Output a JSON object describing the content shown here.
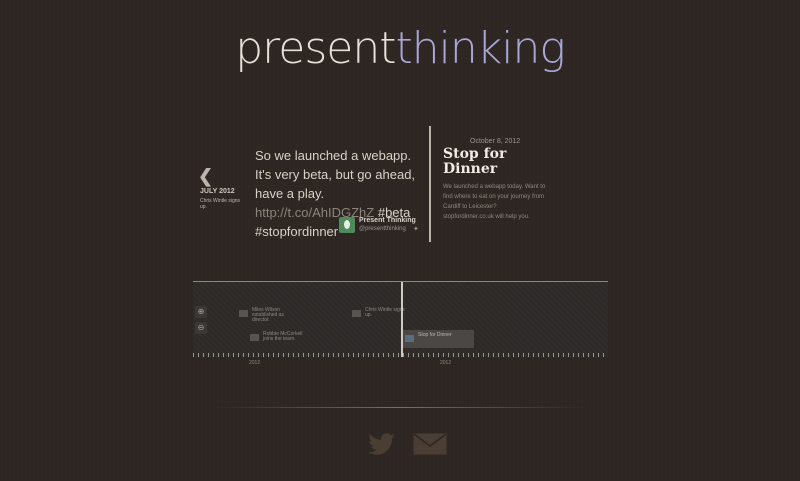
{
  "brand": {
    "part1": "present",
    "part2": "thinking",
    "accent_color": "#a9a6d8"
  },
  "previous": {
    "icon": "chevron-left-icon",
    "date": "JULY 2012",
    "title": "Chris Wintle signs up."
  },
  "tweet": {
    "text_main": "So we launched a webapp. It's very beta, but go ahead, have a play. ",
    "link": "http://t.co/AhIDGZhZ",
    "hashtags": "#beta #stopfordinner",
    "author_name": "Present Thinking",
    "author_handle": "@presentthinking"
  },
  "event": {
    "date": "October 8, 2012",
    "title": "Stop for Dinner",
    "description": "We launched a webapp today. Want to find where to eat on your journey from Cardiff to Leicester? stopfordinner.co.uk will help you."
  },
  "timeline": {
    "markers": [
      {
        "text": "Miles Wilson established as director."
      },
      {
        "text": "Robbie McCorkell joins the team."
      },
      {
        "text": "Chris Wintle signs up."
      },
      {
        "text": "Stop for Dinner"
      }
    ],
    "tick_labels": [
      "2012",
      "2012"
    ]
  },
  "social": {
    "twitter_icon": "twitter-bird-icon",
    "mail_icon": "mail-envelope-icon"
  }
}
